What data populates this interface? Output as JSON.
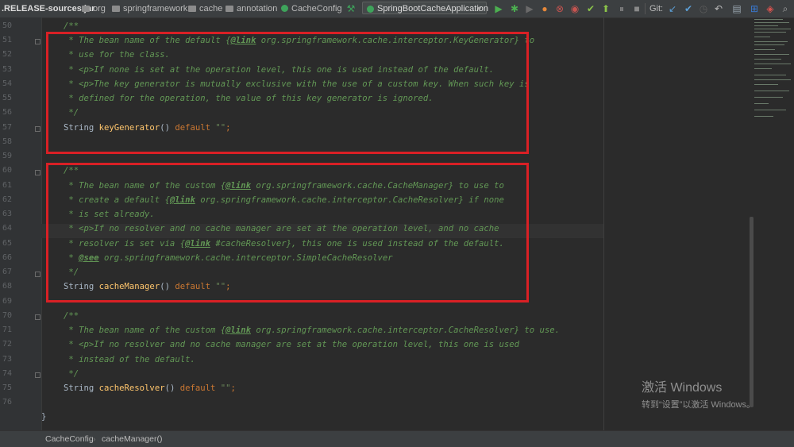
{
  "breadcrumbs": [
    ".RELEASE-sources.jar",
    "org",
    "springframework",
    "cache",
    "annotation",
    "CacheConfig"
  ],
  "run_config": "SpringBootCacheApplication",
  "vcs_label": "Git:",
  "line_numbers": [
    "50",
    "51",
    "52",
    "53",
    "54",
    "55",
    "56",
    "57",
    "58",
    "59",
    "60",
    "61",
    "62",
    "63",
    "64",
    "65",
    "66",
    "67",
    "68",
    "69",
    "70",
    "71",
    "72",
    "73",
    "74",
    "75",
    "76"
  ],
  "code": {
    "l50": "/**",
    "l51_a": " * The bean name of the default ",
    "l51_tag": "@link",
    "l51_b": " org.springframework.cache.interceptor.KeyGenerator} to",
    "l51_pre": "{",
    "l52": " * use for the class.",
    "l53": " * <p>If none is set at the operation level, this one is used instead of the default.",
    "l54": " * <p>The key generator is mutually exclusive with the use of a custom key. When such key is",
    "l55": " * defined for the operation, the value of this key generator is ignored.",
    "l56": " */",
    "l57_type": "String ",
    "l57_fn": "keyGenerator",
    "l57_par": "() ",
    "l57_kw": "default ",
    "l57_str": "\"\"",
    "l57_end": ";",
    "l59": "/**",
    "l60_a": " * The bean name of the custom ",
    "l60_pre": "{",
    "l60_tag": "@link",
    "l60_b": " org.springframework.cache.CacheManager} to use to",
    "l61_a": " * create a default ",
    "l61_pre": "{",
    "l61_tag": "@link",
    "l61_b": " org.springframework.cache.interceptor.CacheResolver} if none",
    "l62": " * is set already.",
    "l63": " * <p>If no resolver and no cache manager are set at the operation level, and no cache",
    "l64_a": " * resolver is set via ",
    "l64_pre": "{",
    "l64_tag": "@link",
    "l64_b": " #cacheResolver}, this one is used instead of the default.",
    "l65_a": " * ",
    "l65_tag": "@see",
    "l65_b": " org.springframework.cache.interceptor.SimpleCacheResolver",
    "l66": " */",
    "l67_type": "String ",
    "l67_fn": "cacheManager",
    "l67_par": "() ",
    "l67_kw": "default ",
    "l67_str": "\"\"",
    "l67_end": ";",
    "l69": "/**",
    "l70_a": " * The bean name of the custom ",
    "l70_pre": "{",
    "l70_tag": "@link",
    "l70_b": " org.springframework.cache.interceptor.CacheResolver} to use.",
    "l71": " * <p>If no resolver and no cache manager are set at the operation level, this one is used",
    "l72": " * instead of the default.",
    "l73": " */",
    "l74_type": "String ",
    "l74_fn": "cacheResolver",
    "l74_par": "() ",
    "l74_kw": "default ",
    "l74_str": "\"\"",
    "l74_end": ";",
    "l77": "}"
  },
  "watermark": {
    "line1": "激活 Windows",
    "line2": "转到“设置”以激活 Windows。"
  },
  "status": {
    "crumb1": "CacheConfig",
    "crumb2": "cacheManager()"
  },
  "colors": {
    "highlight_box": "#d92025",
    "comment": "#629755",
    "keyword": "#cc7832",
    "method": "#ffc66d"
  }
}
